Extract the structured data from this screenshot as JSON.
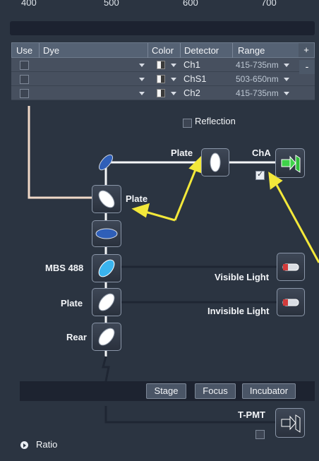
{
  "spectrum": {
    "ticks": [
      "400",
      "500",
      "600",
      "700"
    ]
  },
  "table": {
    "headers": {
      "use": "Use",
      "dye": "Dye",
      "color": "Color",
      "detector": "Detector",
      "range": "Range"
    },
    "add_label": "+",
    "remove_label": "-",
    "rows": [
      {
        "detector": "Ch1",
        "range": "415-735nm"
      },
      {
        "detector": "ChS1",
        "range": "503-650nm"
      },
      {
        "detector": "Ch2",
        "range": "415-735nm"
      }
    ],
    "reflection_label": "Reflection"
  },
  "diagram": {
    "plate_top_label": "Plate",
    "cha_label": "ChA",
    "plate_left_label": "Plate",
    "mbs_label": "MBS 488",
    "plate2_label": "Plate",
    "rear_label": "Rear",
    "visible_light_label": "Visible Light",
    "invisible_light_label": "Invisible Light",
    "tpmt_label": "T-PMT"
  },
  "toolbar": {
    "stage": "Stage",
    "focus": "Focus",
    "incubator": "Incubator"
  },
  "footer": {
    "ratio_label": "Ratio"
  },
  "colors": {
    "background": "#2b3441",
    "accent_arrow": "#f3e83a",
    "beam": "#f5f6f8",
    "laser_line": "#f0d9c8"
  }
}
